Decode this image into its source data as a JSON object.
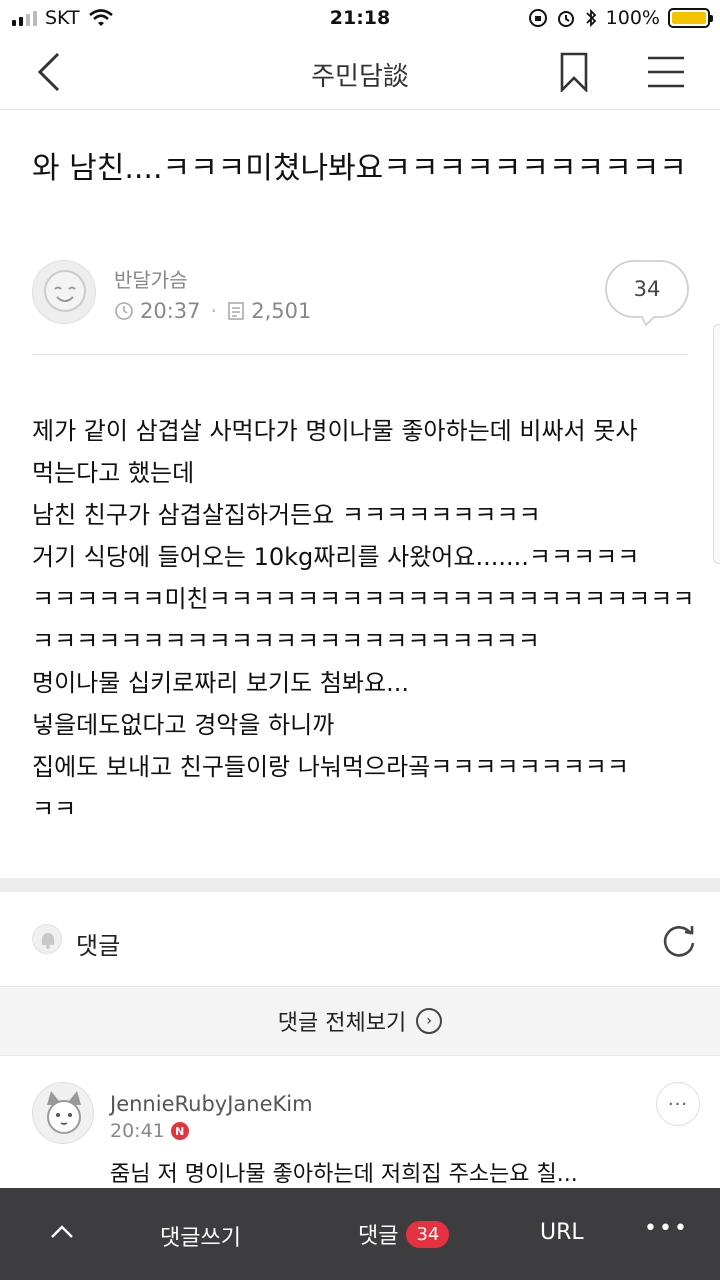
{
  "status_bar": {
    "carrier": "SKT",
    "time": "21:18",
    "battery": "100%"
  },
  "nav": {
    "title": "주민담談"
  },
  "post": {
    "title": "와 남친....ㅋㅋㅋ미쳤나봐요ㅋㅋㅋㅋㅋㅋㅋㅋㅋㅋㅋ",
    "author": "반달가슴",
    "time": "20:37",
    "views": "2,501",
    "comment_count": "34",
    "body_lines": [
      "제가 같이 삼겹살 사먹다가 명이나물 좋아하는데 비싸서 못사",
      "먹는다고 했는데",
      "남친 친구가 삼겹살집하거든요 ㅋㅋㅋㅋㅋㅋㅋㅋㅋ",
      "거기 식당에 들어오는 10kg짜리를 사왔어요.......ㅋㅋㅋㅋㅋ",
      "ㅋㅋㅋㅋㅋㅋ미친ㅋㅋㅋㅋㅋㅋㅋㅋㅋㅋㅋㅋㅋㅋㅋㅋㅋㅋㅋㅋㅋㅋ",
      "ㅋㅋㅋㅋㅋㅋㅋㅋㅋㅋㅋㅋㅋㅋㅋㅋㅋㅋㅋㅋㅋㅋㅋ",
      "명이나물 십키로짜리 보기도 첨봐요...",
      "넣을데도없다고 경악을 하니까",
      "집에도 보내고 친구들이랑 나눠먹으라곸ㅋㅋㅋㅋㅋㅋㅋㅋㅋ",
      "ㅋㅋ"
    ]
  },
  "comments_section": {
    "label": "댓글",
    "view_all": "댓글 전체보기",
    "items": [
      {
        "author": "JennieRubyJaneKim",
        "time": "20:41",
        "badge": "N",
        "text": "줌님 저 명이나물 좋아하는데 저희집 주소는요 칠..."
      }
    ]
  },
  "bottom_bar": {
    "write": "댓글쓰기",
    "comments": "댓글",
    "comment_count": "34",
    "url": "URL"
  },
  "colors": {
    "accent_red": "#e5323e",
    "bottom_bar_bg": "#3d3d3f",
    "battery": "#f5c400"
  }
}
